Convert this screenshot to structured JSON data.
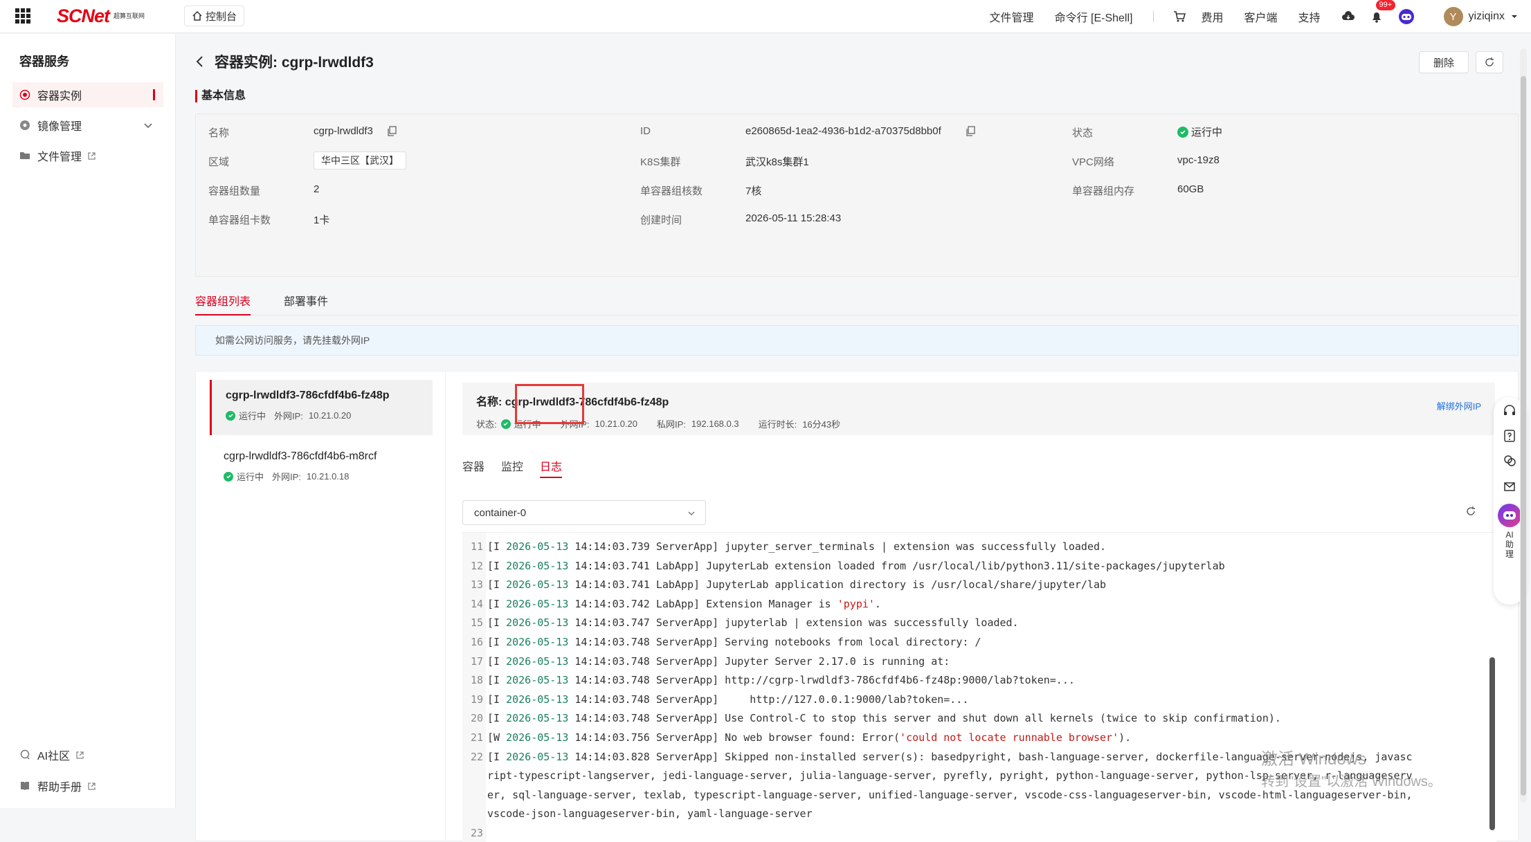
{
  "topbar": {
    "logo_main_red": "SCNet",
    "logo_sub": "超算互联网",
    "console": "控制台",
    "nav": [
      "文件管理",
      "命令行 [E-Shell]",
      "费用",
      "客户端",
      "支持"
    ],
    "badge": "99+",
    "user_initial": "Y",
    "username": "yiziqinx"
  },
  "sidebar": {
    "title": "容器服务",
    "items": [
      {
        "label": "容器实例"
      },
      {
        "label": "镜像管理"
      },
      {
        "label": "文件管理"
      }
    ],
    "bottom": [
      {
        "label": "AI社区"
      },
      {
        "label": "帮助手册"
      }
    ]
  },
  "page": {
    "title": "容器实例: cgrp-lrwdldf3",
    "delete_label": "删除",
    "section_label": "基本信息"
  },
  "info": {
    "name_key": "名称",
    "name_val": "cgrp-lrwdldf3",
    "id_key": "ID",
    "id_val": "e260865d-1ea2-4936-b1d2-a70375d8bb0f",
    "status_key": "状态",
    "status_val": "运行中",
    "region_key": "区域",
    "region_val": "华中三区【武汉】",
    "k8s_key": "K8S集群",
    "k8s_val": "武汉k8s集群1",
    "vpc_key": "VPC网络",
    "vpc_val": "vpc-19z8",
    "count_key": "容器组数量",
    "count_val": "2",
    "cores_key": "单容器组核数",
    "cores_val": "7核",
    "mem_key": "单容器组内存",
    "mem_val": "60GB",
    "cards_key": "单容器组卡数",
    "cards_val": "1卡",
    "created_key": "创建时间",
    "created_val": "2026-05-11 15:28:43"
  },
  "tabs": [
    "容器组列表",
    "部署事件"
  ],
  "notice": "如需公网访问服务，请先挂载外网IP",
  "pods": [
    {
      "name": "cgrp-lrwdldf3-786cfdf4b6-fz48p",
      "status": "运行中",
      "ip_label": "外网IP:",
      "ip": "10.21.0.20"
    },
    {
      "name": "cgrp-lrwdldf3-786cfdf4b6-m8rcf",
      "status": "运行中",
      "ip_label": "外网IP:",
      "ip": "10.21.0.18"
    }
  ],
  "detail": {
    "name_label": "名称:",
    "name": "cgrp-lrwdldf3-786cfdf4b6-fz48p",
    "status_label": "状态:",
    "status": "运行中",
    "ext_ip_label": "外网IP:",
    "ext_ip": "10.21.0.20",
    "priv_ip_label": "私网IP:",
    "priv_ip": "192.168.0.3",
    "uptime_label": "运行时长:",
    "uptime": "16分43秒",
    "unbind": "解绑外网IP",
    "subtabs": [
      "容器",
      "监控",
      "日志"
    ],
    "container_select": "container-0"
  },
  "log_lines": [
    {
      "n": "11",
      "pre": "[I ",
      "ts": "2026-05-13",
      "rest": " 14:14:03.739 ServerApp] jupyter_server_terminals | extension was successfully loaded."
    },
    {
      "n": "12",
      "pre": "[I ",
      "ts": "2026-05-13",
      "rest": " 14:14:03.741 LabApp] JupyterLab extension loaded from /usr/local/lib/python3.11/site-packages/jupyterlab"
    },
    {
      "n": "13",
      "pre": "[I ",
      "ts": "2026-05-13",
      "rest": " 14:14:03.741 LabApp] JupyterLab application directory is /usr/local/share/jupyter/lab"
    },
    {
      "n": "14",
      "pre": "[I ",
      "ts": "2026-05-13",
      "rest": " 14:14:03.742 LabApp] Extension Manager is ",
      "str": "'pypi'",
      "post": "."
    },
    {
      "n": "15",
      "pre": "[I ",
      "ts": "2026-05-13",
      "rest": " 14:14:03.747 ServerApp] jupyterlab | extension was successfully loaded."
    },
    {
      "n": "16",
      "pre": "[I ",
      "ts": "2026-05-13",
      "rest": " 14:14:03.748 ServerApp] Serving notebooks from local directory: /"
    },
    {
      "n": "17",
      "pre": "[I ",
      "ts": "2026-05-13",
      "rest": " 14:14:03.748 ServerApp] Jupyter Server 2.17.0 is running at:"
    },
    {
      "n": "18",
      "pre": "[I ",
      "ts": "2026-05-13",
      "rest": " 14:14:03.748 ServerApp] http://cgrp-lrwdldf3-786cfdf4b6-fz48p:9000/lab?token=..."
    },
    {
      "n": "19",
      "pre": "[I ",
      "ts": "2026-05-13",
      "rest": " 14:14:03.748 ServerApp]     http://127.0.0.1:9000/lab?token=..."
    },
    {
      "n": "20",
      "pre": "[I ",
      "ts": "2026-05-13",
      "rest": " 14:14:03.748 ServerApp] Use Control-C to stop this server and shut down all kernels (twice to skip confirmation)."
    },
    {
      "n": "21",
      "pre": "[W ",
      "ts": "2026-05-13",
      "rest": " 14:14:03.756 ServerApp] No web browser found: Error(",
      "str": "'could not locate runnable browser'",
      "post": ")."
    },
    {
      "n": "22",
      "pre": "[I ",
      "ts": "2026-05-13",
      "rest": " 14:14:03.828 ServerApp] Skipped non-installed server(s): basedpyright, bash-language-server, dockerfile-language-server-nodejs, javasc"
    },
    {
      "n": "",
      "pre": "",
      "ts": "",
      "rest": "ript-typescript-langserver, jedi-language-server, julia-language-server, pyrefly, pyright, python-language-server, python-lsp-server, r-languageserv"
    },
    {
      "n": "",
      "pre": "",
      "ts": "",
      "rest": "er, sql-language-server, texlab, typescript-language-server, unified-language-server, vscode-css-languageserver-bin, vscode-html-languageserver-bin,"
    },
    {
      "n": "",
      "pre": "",
      "ts": "",
      "rest": "vscode-json-languageserver-bin, yaml-language-server"
    },
    {
      "n": "23",
      "pre": "",
      "ts": "",
      "rest": ""
    }
  ],
  "float": {
    "ai_label": "AI助理"
  },
  "watermark": {
    "line1": "激活 Windows",
    "line2": "转到\"设置\"以激活 Windows。"
  }
}
